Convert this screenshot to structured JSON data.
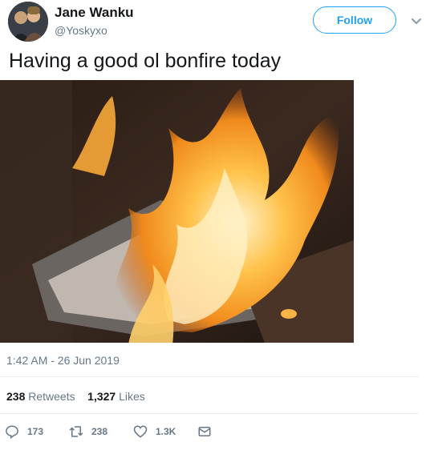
{
  "author": {
    "name": "Jane Wanku",
    "handle": "@Yoskyxo"
  },
  "follow_label": "Follow",
  "tweet": {
    "text": "Having a good ol bonfire today"
  },
  "timestamp": "1:42 AM - 26 Jun 2019",
  "stats": {
    "retweets_count": "238",
    "retweets_label": "Retweets",
    "likes_count": "1,327",
    "likes_label": "Likes"
  },
  "actions": {
    "replies": "173",
    "retweets": "238",
    "likes": "1.3K"
  },
  "icons": {
    "reply": "reply-icon",
    "retweet": "retweet-icon",
    "like": "heart-icon",
    "message": "envelope-icon",
    "menu": "chevron-down-icon"
  },
  "colors": {
    "accent": "#1da1f2",
    "secondary_text": "#657786",
    "divider": "#e6ecf0"
  }
}
